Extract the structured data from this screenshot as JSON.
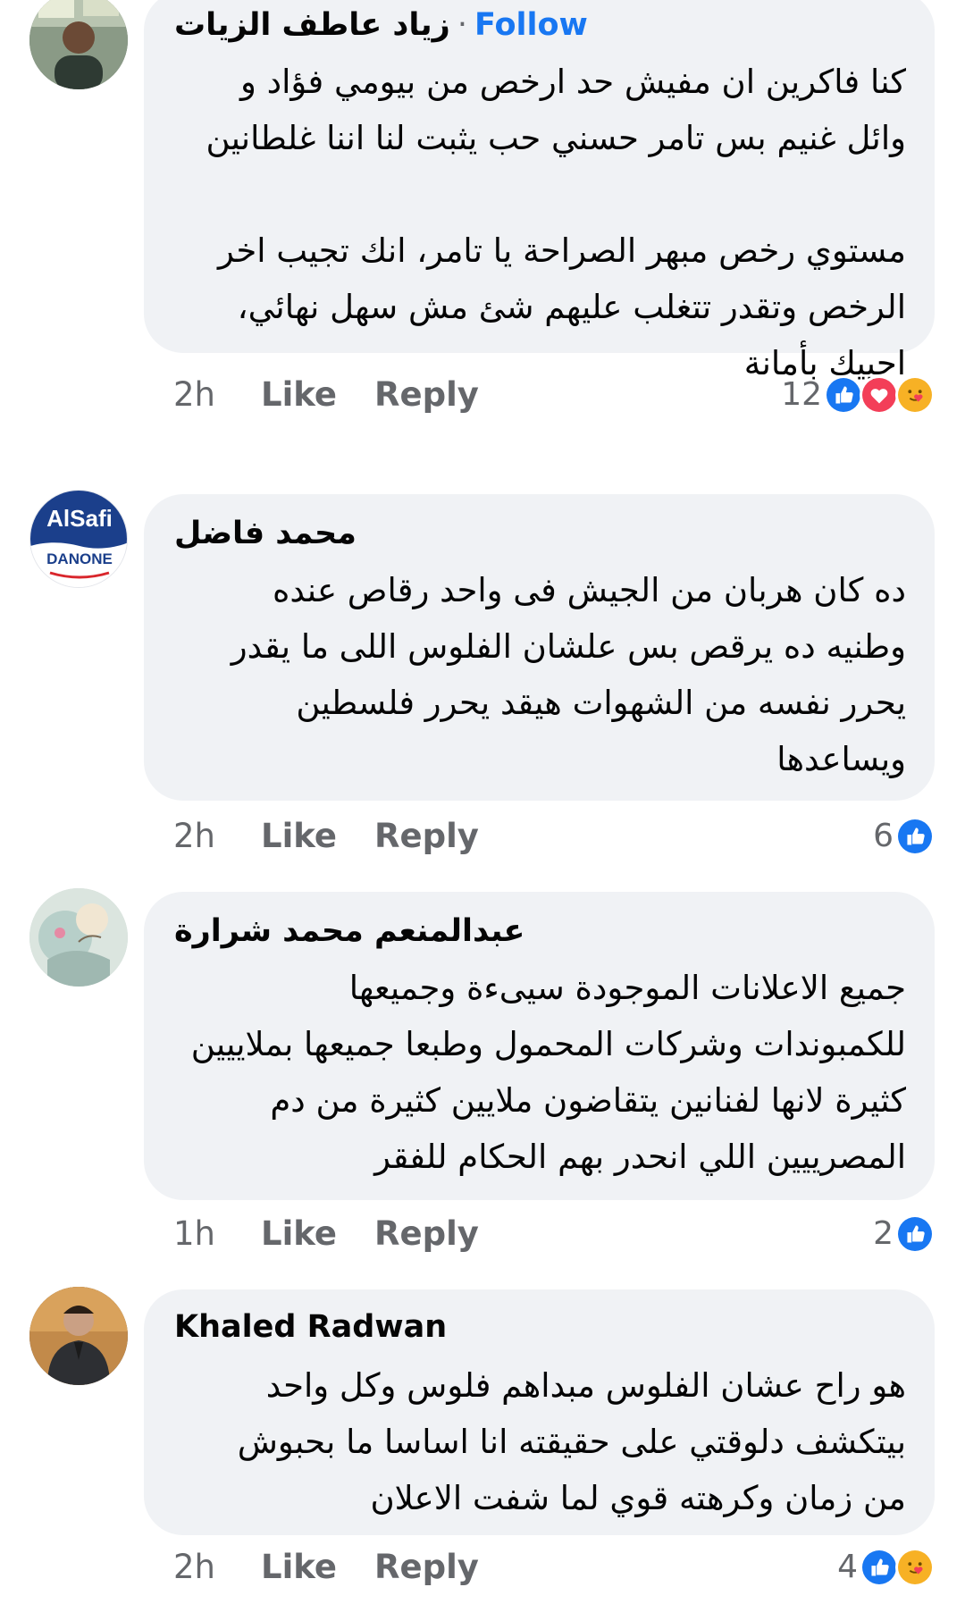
{
  "colors": {
    "accent": "#1877f2",
    "bubble": "#f0f2f5",
    "muted": "#65676b",
    "love": "#f33e58",
    "care": "#f7b125"
  },
  "comments": [
    {
      "author": "زياد عاطف الزيات",
      "follow": "Follow",
      "lines": [
        "كنا فاكرين ان مفيش حد ارخص من بيومي فؤاد و",
        "وائل غنيم بس تامر حسني حب يثبت لنا اننا غلطانين",
        "",
        "مستوي رخص مبهر الصراحة يا تامر، انك تجيب اخر",
        "الرخص وتقدر تتغلب عليهم شئ مش سهل نهائي،",
        "احييك بأمانة"
      ],
      "time": "2h",
      "like": "Like",
      "reply": "Reply",
      "count": "12",
      "reactions": [
        "like-icon",
        "love-icon",
        "care-icon"
      ]
    },
    {
      "author": "محمد فاضل",
      "avatar_text": {
        "top": "AlSafi",
        "bottom": "DANONE"
      },
      "lines": [
        "ده كان هربان من الجيش فى واحد رقاص عنده",
        "وطنيه ده يرقص بس علشان الفلوس اللى ما يقدر",
        "يحرر نفسه من الشهوات هيقد يحرر فلسطين",
        "ويساعدها"
      ],
      "time": "2h",
      "like": "Like",
      "reply": "Reply",
      "count": "6",
      "reactions": [
        "like-icon"
      ]
    },
    {
      "author": "عبدالمنعم محمد شرارة",
      "lines": [
        "جميع الاعلانات الموجودة سيىءة وجميعها",
        "للكمبوندات وشركات المحمول وطبعا جميعها بملاييين",
        "كثيرة لانها لفنانين  يتقاضون ملايين كثيرة  من دم",
        "المصرييين اللي انحدر بهم الحكام للفقر"
      ],
      "time": "1h",
      "like": "Like",
      "reply": "Reply",
      "count": "2",
      "reactions": [
        "like-icon"
      ]
    },
    {
      "author": "Khaled Radwan",
      "lines": [
        "هو راح عشان الفلوس مبداهم فلوس وكل واحد",
        "بيتكشف دلوقتي على حقيقته انا اساسا ما بحبوش",
        "من زمان وكرهته قوي لما شفت الاعلان"
      ],
      "time": "2h",
      "like": "Like",
      "reply": "Reply",
      "count": "4",
      "reactions": [
        "like-icon",
        "care-icon"
      ]
    }
  ]
}
